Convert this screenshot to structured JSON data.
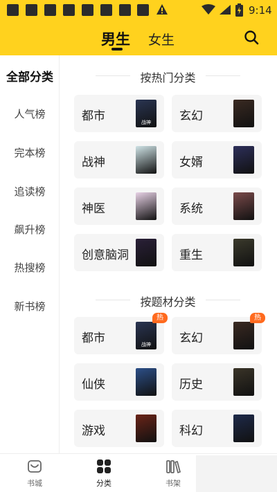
{
  "status_bar": {
    "time": "9:14",
    "notification_icons": [
      "notification-icon",
      "notification-icon",
      "notification-icon",
      "notification-icon",
      "notification-icon",
      "notification-icon",
      "notification-icon",
      "notification-icon"
    ],
    "warning_icon": "warning-icon",
    "wifi_icon": "wifi-icon",
    "signal_icon": "signal-icon",
    "battery_icon": "battery-charging-icon"
  },
  "header": {
    "tabs": [
      {
        "label": "男生",
        "active": true
      },
      {
        "label": "女生",
        "active": false
      }
    ],
    "search_icon": "search-icon",
    "background_color": "#FFD21E"
  },
  "sidebar": {
    "items": [
      {
        "label": "全部分类",
        "active": true
      },
      {
        "label": "人气榜",
        "active": false
      },
      {
        "label": "完本榜",
        "active": false
      },
      {
        "label": "追读榜",
        "active": false
      },
      {
        "label": "飙升榜",
        "active": false
      },
      {
        "label": "热搜榜",
        "active": false
      },
      {
        "label": "新书榜",
        "active": false
      }
    ]
  },
  "sections": [
    {
      "title": "按热门分类",
      "categories": [
        {
          "label": "都市",
          "cover_text": "战神",
          "cover_color": "#2a3552",
          "hot": false
        },
        {
          "label": "玄幻",
          "cover_text": "",
          "cover_color": "#3a2a22",
          "hot": false
        },
        {
          "label": "战神",
          "cover_text": "",
          "cover_color": "#cfe3e6",
          "hot": false
        },
        {
          "label": "女婿",
          "cover_text": "",
          "cover_color": "#2d2f5a",
          "hot": false
        },
        {
          "label": "神医",
          "cover_text": "",
          "cover_color": "#e8d2e6",
          "hot": false
        },
        {
          "label": "系统",
          "cover_text": "",
          "cover_color": "#7a4a4a",
          "hot": false
        },
        {
          "label": "创意脑洞",
          "cover_text": "",
          "cover_color": "#2a2038",
          "hot": false
        },
        {
          "label": "重生",
          "cover_text": "",
          "cover_color": "#3b3a2c",
          "hot": false
        }
      ]
    },
    {
      "title": "按题材分类",
      "categories": [
        {
          "label": "都市",
          "cover_text": "战神",
          "cover_color": "#2a3552",
          "hot": true
        },
        {
          "label": "玄幻",
          "cover_text": "",
          "cover_color": "#3a2a22",
          "hot": true
        },
        {
          "label": "仙侠",
          "cover_text": "",
          "cover_color": "#2c4f88",
          "hot": false
        },
        {
          "label": "历史",
          "cover_text": "",
          "cover_color": "#3a3428",
          "hot": false
        },
        {
          "label": "游戏",
          "cover_text": "",
          "cover_color": "#6a2418",
          "hot": false
        },
        {
          "label": "科幻",
          "cover_text": "",
          "cover_color": "#1e2a4a",
          "hot": false
        }
      ]
    }
  ],
  "hot_badge_label": "热",
  "bottom_nav": {
    "items": [
      {
        "label": "书城",
        "icon": "bookstore-icon",
        "active": false
      },
      {
        "label": "分类",
        "icon": "category-grid-icon",
        "active": true
      },
      {
        "label": "书架",
        "icon": "bookshelf-icon",
        "active": false
      }
    ]
  }
}
